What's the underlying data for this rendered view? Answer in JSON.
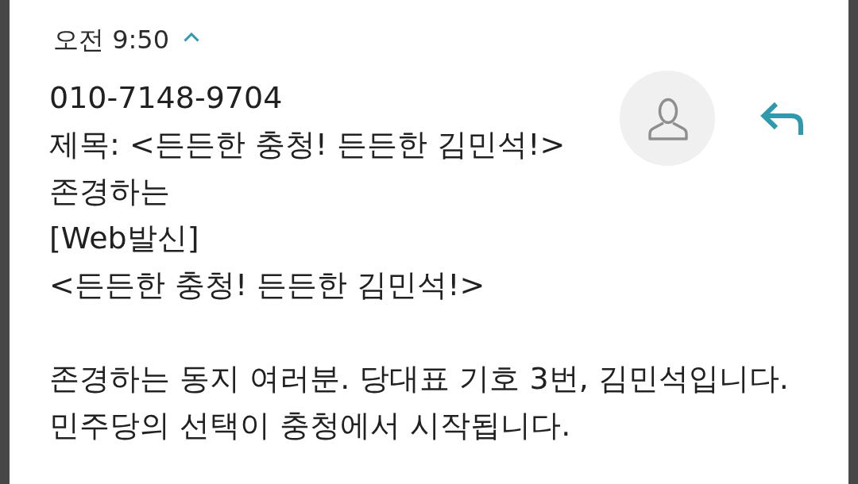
{
  "message": {
    "time": "오전 9:50",
    "expanded": true,
    "paragraphs": [
      {
        "lines": [
          "010-7148-9704",
          "제목: <든든한 충청! 든든한 김민석!>",
          "존경하는",
          "[Web발신]",
          "<든든한 충청! 든든한 김민석!>"
        ]
      },
      {
        "lines": [
          "존경하는 동지 여러분. 당대표 기호 3번, 김민석입니다.",
          "민주당의 선택이 충청에서 시작됩니다."
        ]
      }
    ]
  }
}
